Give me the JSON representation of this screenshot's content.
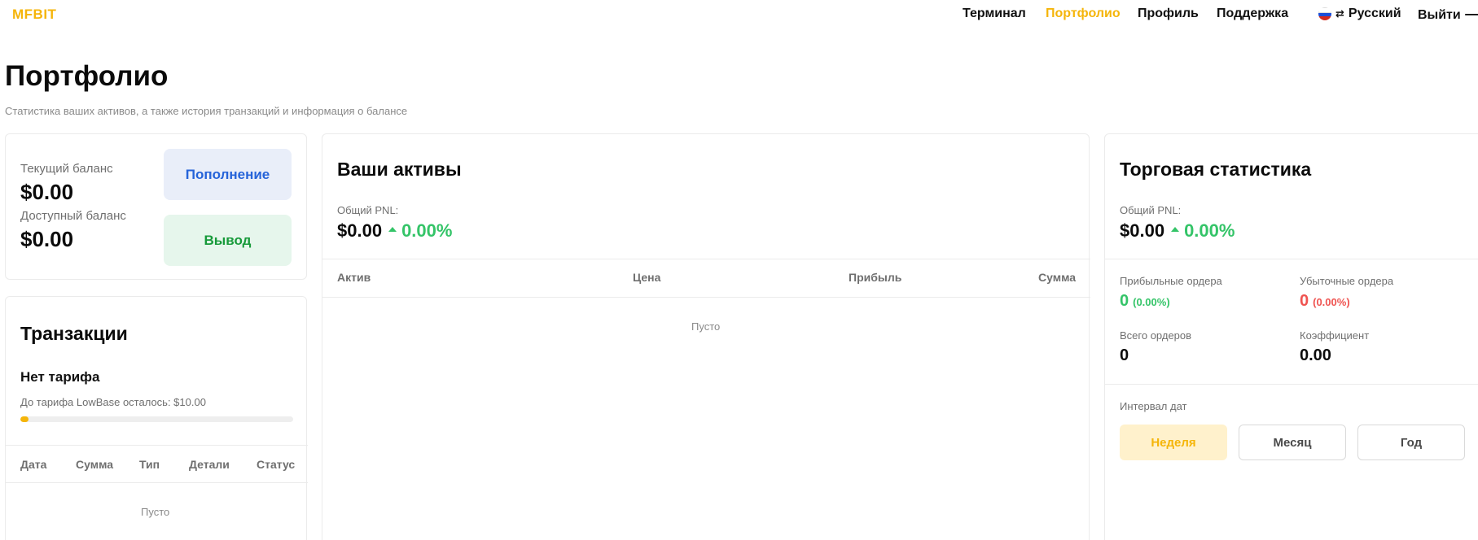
{
  "header": {
    "logo": "MFBIT",
    "nav": [
      "Терминал",
      "Портфолио",
      "Профиль",
      "Поддержка"
    ],
    "language": "Русский",
    "logout": "Выйти"
  },
  "page": {
    "title": "Портфолио",
    "subtitle": "Статистика ваших активов, а также история транзакций и информация о балансе"
  },
  "balance": {
    "current_label": "Текущий баланс",
    "current_value": "$0.00",
    "available_label": "Доступный баланс",
    "available_value": "$0.00",
    "deposit_label": "Пополнение",
    "withdraw_label": "Вывод"
  },
  "transactions": {
    "title": "Транзакции",
    "tariff_title": "Нет тарифа",
    "tariff_text": "До тарифа LowBase осталось: $10.00",
    "progress": 0.03,
    "columns": [
      "Дата",
      "Сумма",
      "Тип",
      "Детали",
      "Статус"
    ],
    "empty": "Пусто"
  },
  "assets": {
    "title": "Ваши активы",
    "pnl_label": "Общий PNL:",
    "pnl_value": "$0.00",
    "pnl_pct": "0.00%",
    "columns": [
      "Актив",
      "Цена",
      "Прибыль",
      "Сумма"
    ],
    "empty": "Пусто"
  },
  "stats": {
    "title": "Торговая статистика",
    "pnl_label": "Общий PNL:",
    "pnl_value": "$0.00",
    "pnl_pct": "0.00%",
    "profit_orders_label": "Прибыльные ордера",
    "profit_orders_value": "0",
    "profit_orders_pct": "(0.00%)",
    "loss_orders_label": "Убыточные ордера",
    "loss_orders_value": "0",
    "loss_orders_pct": "(0.00%)",
    "total_orders_label": "Всего ордеров",
    "total_orders_value": "0",
    "ratio_label": "Коэффициент",
    "ratio_value": "0.00",
    "interval_label": "Интервал дат",
    "ranges": [
      "Неделя",
      "Месяц",
      "Год"
    ],
    "active_range": "Неделя"
  },
  "colors": {
    "accent": "#f5b50a",
    "positive": "#34c468",
    "negative": "#ef5350",
    "deposit": "#2563d9",
    "withdraw": "#179a3a"
  },
  "icons": [
    "flag-ru-icon",
    "swap-icon",
    "arrow-right-icon",
    "arrow-up-icon"
  ]
}
